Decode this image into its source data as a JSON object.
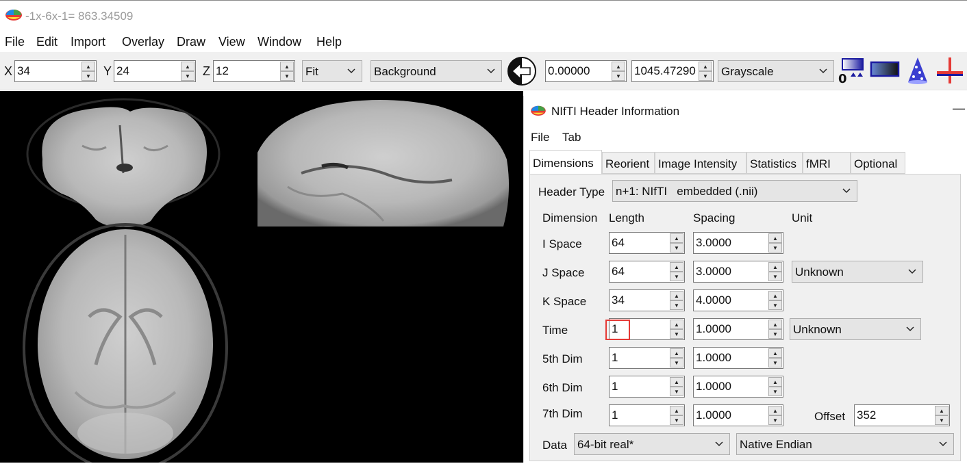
{
  "window": {
    "title": "-1x-6x-1= 863.34509"
  },
  "menu": [
    "File",
    "Edit",
    "Import",
    "Overlay",
    "Draw",
    "View",
    "Window",
    "Help"
  ],
  "toolbar": {
    "x_label": "X",
    "x_value": "34",
    "y_label": "Y",
    "y_value": "24",
    "z_label": "Z",
    "z_value": "12",
    "zoom": "Fit",
    "layer": "Background",
    "min_value": "0.00000",
    "max_value": "1045.47290",
    "colormap": "Grayscale"
  },
  "dialog": {
    "title": "NIfTI Header Information",
    "menu": [
      "File",
      "Tab"
    ],
    "tabs": [
      "Dimensions",
      "Reorient",
      "Image Intensity",
      "Statistics",
      "fMRI",
      "Optional"
    ],
    "active_tab": "Dimensions",
    "header_type_label": "Header Type",
    "header_type_value": "n+1: NIfTI   embedded (.nii)",
    "columns": {
      "dimension": "Dimension",
      "length": "Length",
      "spacing": "Spacing",
      "unit": "Unit"
    },
    "rows": [
      {
        "label": "I Space",
        "length": "64",
        "spacing": "3.0000",
        "unit": ""
      },
      {
        "label": "J Space",
        "length": "64",
        "spacing": "3.0000",
        "unit": "Unknown"
      },
      {
        "label": "K Space",
        "length": "34",
        "spacing": "4.0000",
        "unit": ""
      },
      {
        "label": "Time",
        "length": "1",
        "spacing": "1.0000",
        "unit": "Unknown"
      },
      {
        "label": "5th Dim",
        "length": "1",
        "spacing": "1.0000",
        "unit": ""
      },
      {
        "label": "6th Dim",
        "length": "1",
        "spacing": "1.0000",
        "unit": ""
      },
      {
        "label": "7th Dim",
        "length": "1",
        "spacing": "1.0000",
        "unit": ""
      }
    ],
    "offset_label": "Offset",
    "offset_value": "352",
    "data_label": "Data",
    "data_type": "64-bit real*",
    "endian": "Native Endian",
    "minimize_glyph": "—"
  },
  "icons": {
    "app": "mricrogl-logo-icon",
    "back": "back-arrow-icon",
    "colorbar": "colorbar-icon",
    "gradient": "gradient-icon",
    "render": "render-wizard-icon",
    "crosshair": "crosshair-icon"
  }
}
